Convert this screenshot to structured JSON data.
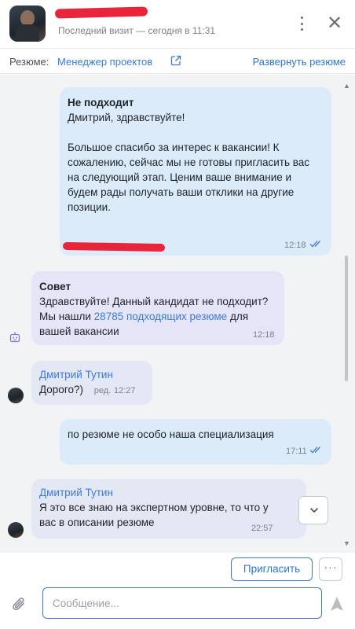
{
  "header": {
    "last_visit": "Последний визит — сегодня в 11:31"
  },
  "resume_bar": {
    "label": "Резюме:",
    "link": "Менеджер проектов",
    "expand": "Развернуть резюме"
  },
  "messages": [
    {
      "type": "outgoing",
      "title": "Не подходит",
      "text": "Дмитрий, здравствуйте!\n\nБольшое спасибо за интерес к вакансии! К сожалению, сейчас мы не готовы пригласить вас на следующий этап. Ценим ваше внимание и будем рады получать ваши отклики на другие позиции.",
      "time": "12:18"
    },
    {
      "type": "system",
      "title": "Совет",
      "text_before": "Здравствуйте! Данный кандидат не подходит? Мы нашли ",
      "link": "28785 подходящих резюме",
      "text_after": " для вашей вакансии",
      "time": "12:18"
    },
    {
      "type": "incoming",
      "sender": "Дмитрий Тутин",
      "text": "Дорого?)",
      "edited": "ред.",
      "time": "12:27"
    },
    {
      "type": "outgoing",
      "text": "по резюме не особо наша специализация",
      "time": "17:11"
    },
    {
      "type": "incoming",
      "sender": "Дмитрий Тутин",
      "text": "Я это все знаю на экспертном уровне, то что у вас в описании резюме",
      "time": "22:57"
    }
  ],
  "actions": {
    "invite": "Пригласить",
    "more": "···"
  },
  "composer": {
    "placeholder": "Сообщение..."
  },
  "colors": {
    "accent": "#3b7bd8",
    "outgoing_bubble": "#dcebfa",
    "system_bubble": "#e6e4f7",
    "incoming_bubble": "#e4e8f4",
    "redaction": "#e8253a"
  },
  "icons": [
    "kebab-menu-icon",
    "close-icon",
    "external-link-icon",
    "double-check-icon",
    "bot-icon",
    "chevron-down-icon",
    "paperclip-icon",
    "send-icon"
  ]
}
